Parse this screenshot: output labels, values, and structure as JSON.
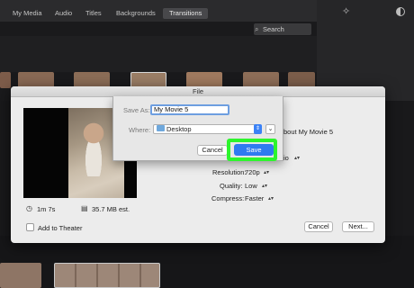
{
  "toolbar": {
    "tabs": [
      {
        "label": "My Media"
      },
      {
        "label": "Audio"
      },
      {
        "label": "Titles"
      },
      {
        "label": "Backgrounds"
      },
      {
        "label": "Transitions"
      }
    ],
    "active_tab": "Transitions",
    "search_label": "Search"
  },
  "dialog": {
    "title": "File",
    "description_partial": "bout My Movie 5",
    "ratio_partial": "io",
    "resolution_label": "Resolution:",
    "resolution_value": "720p",
    "quality_label": "Quality:",
    "quality_value": "Low",
    "compress_label": "Compress:",
    "compress_value": "Faster",
    "duration": "1m 7s",
    "file_size": "35.7 MB est.",
    "add_to_theater_label": "Add to Theater",
    "cancel_label": "Cancel",
    "next_label": "Next..."
  },
  "save_sheet": {
    "save_as_label": "Save As:",
    "save_as_value": "My Movie 5",
    "where_label": "Where:",
    "where_value": "Desktop",
    "cancel_label": "Cancel",
    "save_label": "Save"
  },
  "colors": {
    "accent_blue": "#2f7bf0",
    "highlight_green": "#2df52d"
  }
}
